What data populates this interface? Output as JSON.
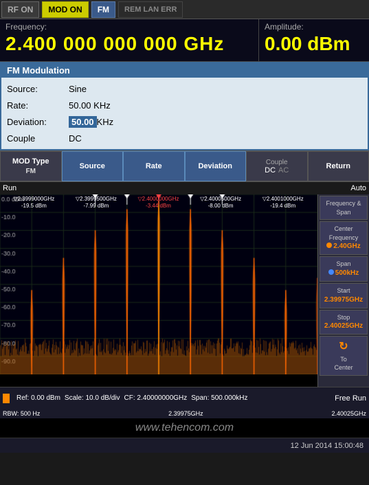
{
  "topbar": {
    "rfon_label": "RF ON",
    "modon_label": "MOD ON",
    "fm_label": "FM",
    "rem_lan_err_label": "REM LAN ERR"
  },
  "frequency": {
    "label": "Frequency:",
    "value": "2.400 000 000 000 GHz"
  },
  "amplitude": {
    "label": "Amplitude:",
    "value": "0.00  dBm"
  },
  "fm_panel": {
    "title": "FM Modulation",
    "source_label": "Source:",
    "source_value": "Sine",
    "rate_label": "Rate:",
    "rate_value": "50.00 KHz",
    "deviation_label": "Deviation:",
    "deviation_value": "50.00",
    "deviation_unit": "KHz",
    "couple_label": "Couple",
    "couple_value": "DC"
  },
  "buttons": {
    "mod_type_label": "MOD Type",
    "mod_type_value": "FM",
    "source_label": "Source",
    "rate_label": "Rate",
    "deviation_label": "Deviation",
    "couple_label": "Couple",
    "couple_dc": "DC",
    "couple_ac": "AC",
    "return_label": "Return"
  },
  "spectrum": {
    "run_label": "Run",
    "auto_label": "Auto",
    "ref_label": "Ref: 0.00 dBm",
    "scale_label": "Scale: 10.0 dB/div",
    "cf_label": "CF: 2.40000000GHz",
    "span_label": "Span: 500.000kHz",
    "rbw_label": "RBW: 500 Hz",
    "free_run_label": "Free Run",
    "markers": [
      {
        "freq": "▽2.3999000GHz",
        "val": "-19.5 dBm"
      },
      {
        "freq": "▽2.3999500GHz",
        "val": "-7.99 dBm"
      },
      {
        "freq": "▽2.4000000GHz",
        "val": "-3.44 dBm",
        "active": true
      },
      {
        "freq": "▽2.4000500GHz",
        "val": "-8.00 dBm"
      },
      {
        "freq": "▽2.4001000GHz",
        "val": "-19.4 dBm"
      }
    ]
  },
  "right_panel": {
    "freq_span_label": "Frequency &\nSpan",
    "center_freq_label": "Center\nFrequency",
    "center_freq_val": "2.40GHz",
    "span_label": "Span",
    "span_val": "500kHz",
    "start_label": "Start",
    "start_val": "2.39975GHz",
    "stop_label": "Stop",
    "stop_val": "2.40025GHz",
    "to_center_label": "To\nCenter"
  },
  "bottom": {
    "start_freq": "2.39975GHz",
    "stop_freq": "2.40025GHz"
  },
  "watermark": "www.tehencom.com",
  "datetime": "12 Jun 2014    15:00:48"
}
